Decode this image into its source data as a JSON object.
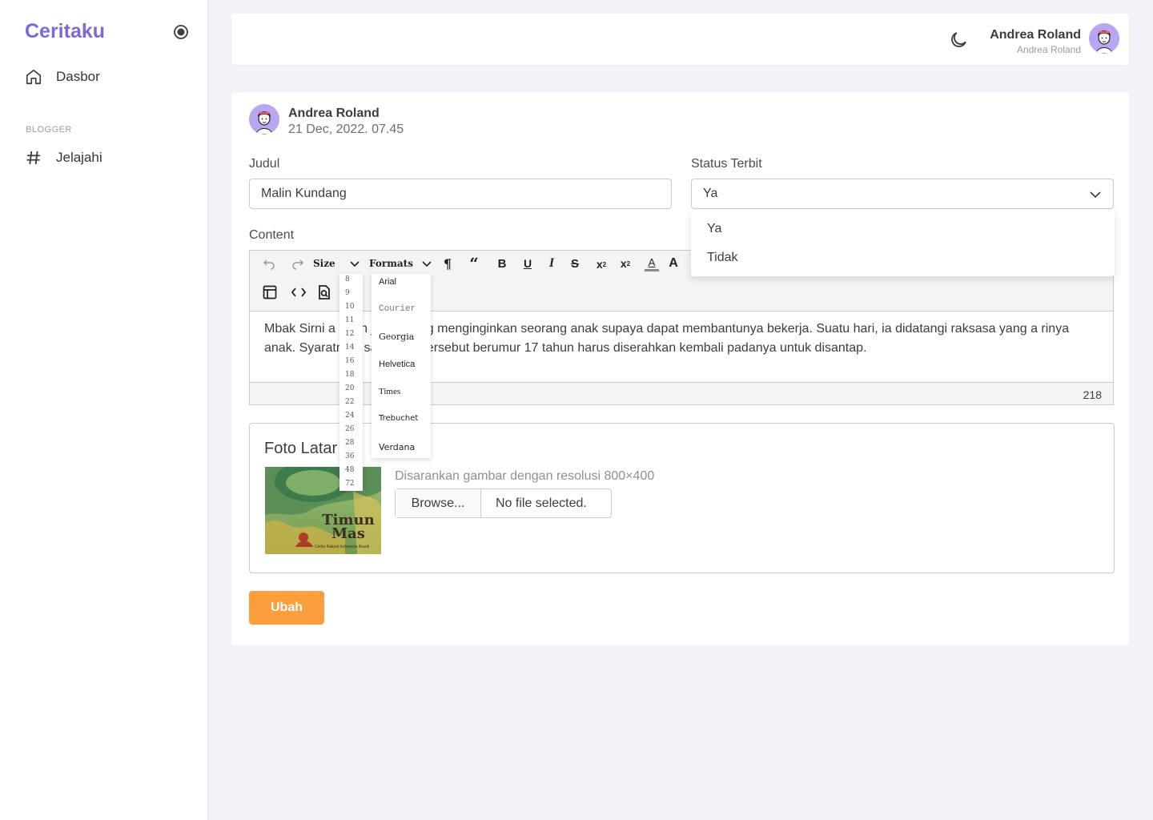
{
  "brand": "Ceritaku",
  "sidebar": {
    "items": [
      {
        "label": "Dasbor",
        "icon": "home-icon"
      },
      {
        "label": "Jelajahi",
        "icon": "hash-icon"
      }
    ],
    "section_label": "BLOGGER"
  },
  "topbar": {
    "user_name": "Andrea Roland",
    "user_sub": "Andrea Roland"
  },
  "post": {
    "author": "Andrea Roland",
    "date": "21 Dec, 2022. 07.45",
    "judul_label": "Judul",
    "judul_value": "Malin Kundang",
    "status_label": "Status Terbit",
    "status_value": "Ya",
    "status_options": [
      "Ya",
      "Tidak"
    ],
    "content_label": "Content",
    "content_text": "Mbak Sirni a  ahun  janda yang menginginkan seorang anak supaya dapat membantunya bekerja. Suatu hari, ia didatangi raksasa yang  a   rinya anak. Syaratnya, saat anak tersebut berumur 17 tahun harus diserahkan kembali padanya untuk disantap.",
    "word_count": "218"
  },
  "editor": {
    "size_label": "Size",
    "formats_label": "Formats",
    "sizes": [
      "8",
      "9",
      "10",
      "11",
      "12",
      "14",
      "16",
      "18",
      "20",
      "22",
      "24",
      "26",
      "28",
      "36",
      "48",
      "72"
    ],
    "fonts": [
      "Arial",
      "Courier",
      "Georgia",
      "Helvetica",
      "Times",
      "Trebuchet",
      "Verdana"
    ]
  },
  "foto": {
    "title": "Foto Latar",
    "hint": "Disarankan gambar dengan resolusi 800×400",
    "browse_label": "Browse...",
    "no_file_label": "No file selected.",
    "thumb_title": "Timun Mas",
    "thumb_sub": "Cerita Rakyat Indonesia Klasik"
  },
  "submit_label": "Ubah",
  "colors": {
    "brand": "#7a6ad8",
    "submit": "#fd9e3e",
    "avatar": "#b9a6f2"
  }
}
